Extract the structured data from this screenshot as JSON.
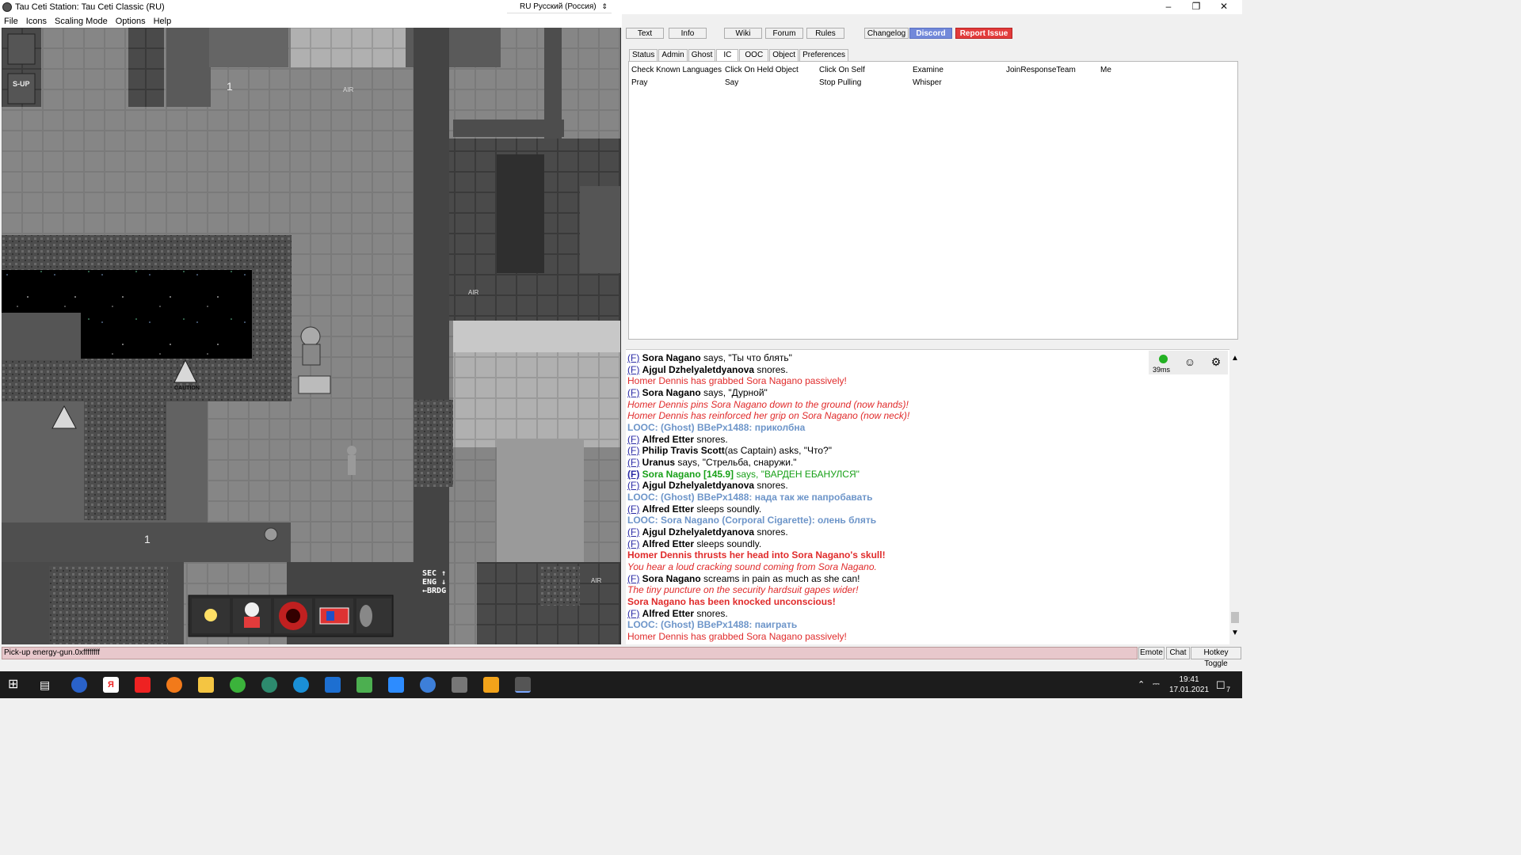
{
  "window": {
    "title": "Tau Ceti Station: Tau Ceti Classic (RU)",
    "language": "RU Русский (Россия)"
  },
  "menu": [
    "File",
    "Icons",
    "Scaling Mode",
    "Options",
    "Help"
  ],
  "top_buttons": [
    "Text",
    "Info",
    "Wiki",
    "Forum",
    "Rules",
    "Changelog",
    "Discord",
    "Report Issue"
  ],
  "verb_tabs": [
    "Status",
    "Admin",
    "Ghost",
    "IC",
    "OOC",
    "Object",
    "Preferences"
  ],
  "verbs": [
    "Check Known Languages",
    "Click On Held Object",
    "Click On Self",
    "Examine",
    "JoinResponseTeam",
    "Me",
    "Pray",
    "Say",
    "Stop Pulling",
    "Whisper"
  ],
  "game_labels": {
    "sup": "S-UP",
    "caution": "CAUTION",
    "air1": "AIR",
    "air2": "AIR",
    "air3": "AIR",
    "one1": "1",
    "one2": "1",
    "sec": "SEC ↑",
    "eng": "ENG ↓",
    "brdg": "←BRDG"
  },
  "chat": {
    "ping": "39ms",
    "lines": [
      {
        "f": "(F)",
        "name": "Sora Nagano",
        "text": " says, \"Ты что блять\""
      },
      {
        "f": "(F)",
        "name": "Ajgul Dzhelyaletdyanova",
        "text": " snores."
      },
      {
        "text": "Homer Dennis has grabbed Sora Nagano passively!"
      },
      {
        "f": "(F)",
        "name": "Sora Nagano",
        "text": " says, \"Дурной\""
      },
      {
        "text": "Homer Dennis pins Sora Nagano down to the ground (now hands)!"
      },
      {
        "text": "Homer Dennis has reinforced her grip on Sora Nagano (now neck)!"
      },
      {
        "text": "LOOC: (Ghost) BBePx1488: приколбна"
      },
      {
        "f": "(F)",
        "name": "Alfred Etter",
        "text": " snores."
      },
      {
        "f": "(F)",
        "name": "Philip Travis Scott",
        "text": "(as Captain) asks, \"Что?\""
      },
      {
        "f": "(F)",
        "name": "Uranus",
        "text": " says, \"Стрельба, снаружи.\""
      },
      {
        "f": "(F)",
        "name": "Sora Nagano [145.9]",
        "text": " says, \"ВАРДЕН ЕБАНУЛСЯ\""
      },
      {
        "f": "(F)",
        "name": "Ajgul Dzhelyaletdyanova",
        "text": " snores."
      },
      {
        "text": "LOOC: (Ghost) BBePx1488: нада так же папробавать"
      },
      {
        "f": "(F)",
        "name": "Alfred Etter",
        "text": " sleeps soundly."
      },
      {
        "text": "LOOC: Sora Nagano (Corporal Cigarette): олень блять"
      },
      {
        "f": "(F)",
        "name": "Ajgul Dzhelyaletdyanova",
        "text": " snores."
      },
      {
        "f": "(F)",
        "name": "Alfred Etter",
        "text": " sleeps soundly."
      },
      {
        "text": "Homer Dennis thrusts her head into Sora Nagano's skull!"
      },
      {
        "text": "You hear a loud cracking sound coming from Sora Nagano."
      },
      {
        "f": "(F)",
        "name": "Sora Nagano",
        "text": " screams in pain as much as she can!"
      },
      {
        "text": "The tiny puncture on the security hardsuit gapes wider!"
      },
      {
        "text": "Sora Nagano has been knocked unconscious!"
      },
      {
        "f": "(F)",
        "name": "Alfred Etter",
        "text": " snores."
      },
      {
        "text": "LOOC: (Ghost) BBePx1488: паиграть"
      },
      {
        "text": "Homer Dennis has grabbed Sora Nagano passively!"
      }
    ]
  },
  "input_bar": "Pick-up energy-gun.0xffffffff",
  "bottom_buttons": [
    "Emote",
    "Chat",
    "Hotkey Toggle"
  ],
  "clock": {
    "time": "19:41",
    "date": "17.01.2021"
  },
  "notification_count": "7",
  "colors": {
    "discord": "#7289da",
    "report": "#e23b3b",
    "looc": "#6d95c9",
    "emote_red": "#e02b2b"
  }
}
